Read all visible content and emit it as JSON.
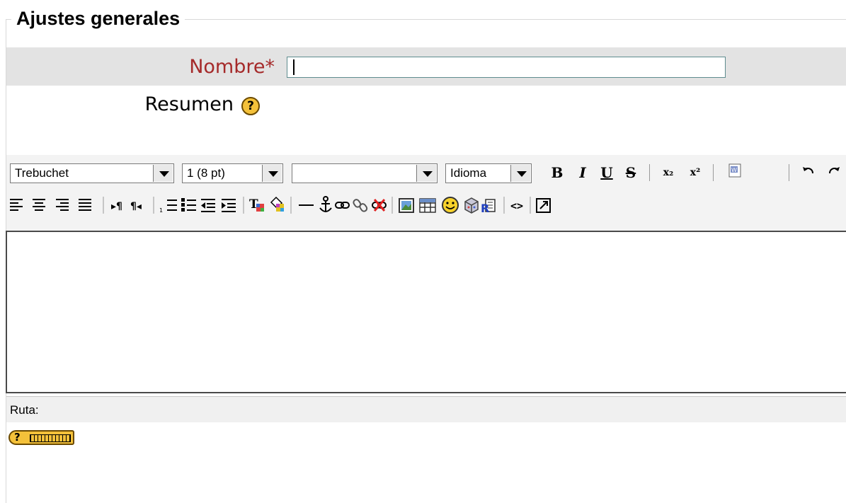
{
  "section": {
    "legend": "Ajustes generales"
  },
  "name_field": {
    "label": "Nombre",
    "required_mark": "*",
    "value": ""
  },
  "summary": {
    "label": "Resumen",
    "help_glyph": "?"
  },
  "toolbar": {
    "font_family": "Trebuchet",
    "font_size": "1 (8 pt)",
    "heading": "",
    "language": "Idioma",
    "row1_icons": [
      "bold-icon",
      "italic-icon",
      "underline-icon",
      "strikethrough-icon",
      "subscript-icon",
      "superscript-icon",
      "paste-word-icon",
      "undo-icon",
      "redo-icon"
    ],
    "row2_icons": [
      "align-left-icon",
      "align-center-icon",
      "align-right-icon",
      "justify-icon",
      "ltr-icon",
      "rtl-icon",
      "ordered-list-icon",
      "unordered-list-icon",
      "outdent-icon",
      "indent-icon",
      "text-color-icon",
      "bg-color-icon",
      "horizontal-rule-icon",
      "anchor-icon",
      "link-icon",
      "unlink-icon",
      "nolink-icon",
      "image-icon",
      "table-icon",
      "smiley-icon",
      "special-char-icon",
      "search-replace-icon",
      "html-source-icon",
      "fullscreen-icon"
    ],
    "glyphs": {
      "bold": "B",
      "italic": "I",
      "underline": "U",
      "strike": "S",
      "sub": "x₂",
      "sup": "x²",
      "html": "<>"
    }
  },
  "editor": {
    "content": ""
  },
  "status": {
    "path_label": "Ruta:"
  },
  "help": {
    "glyph": "?"
  },
  "colors": {
    "required": "#a52a2a",
    "help_yellow": "#f4c13a",
    "band": "#e3e3e3"
  }
}
